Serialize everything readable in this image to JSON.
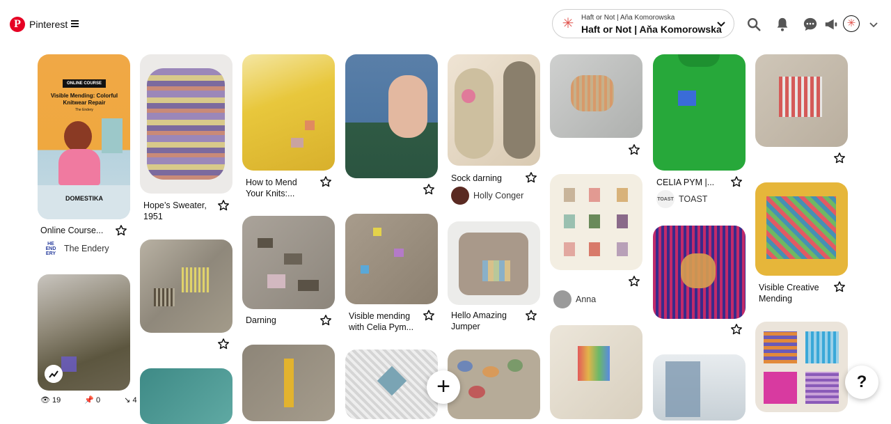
{
  "header": {
    "brand": "Pinterest",
    "board_small": "Haft or Not | Aňa Komorowska",
    "board_big": "Haft or Not | Aňa Komorowska",
    "avatar_glyph": "✳",
    "icons": [
      "search-icon",
      "notifications-icon",
      "messages-icon",
      "updates-icon"
    ]
  },
  "pins": {
    "p1": {
      "title": "Online Course...",
      "creator": "The Endery",
      "creator_badge": "HE END ERY",
      "badge": "ONLINE COURSE",
      "course_title": "Visible Mending: Colorful Knitwear Repair",
      "course_sub": "The Endery",
      "course_brand": "DOMESTIKA"
    },
    "p2": {
      "title": "Hope’s Sweater, 1951"
    },
    "p3": {
      "title": "How to Mend Your Knits:..."
    },
    "p4": {
      "title": ""
    },
    "p5": {
      "title": "Sock darning",
      "creator": "Holly Conger"
    },
    "p6": {
      "title": ""
    },
    "p7": {
      "title": "CELIA PYM |...",
      "creator": "TOAST",
      "creator_badge": "TOAST"
    },
    "p8": {
      "title": ""
    },
    "p10": {
      "title": "Darning"
    },
    "p11": {
      "title": "Visible mending with Celia Pym..."
    },
    "p12": {
      "title": "Hello Amazing Jumper"
    },
    "p13": {
      "title": "",
      "creator": "Anna"
    },
    "p14": {
      "title": "Visible Creative Mending"
    }
  },
  "stats": {
    "views": "19",
    "saves": "0",
    "clicks": "4"
  },
  "fab_label": "+",
  "help_label": "?",
  "colors": {
    "brand_red": "#e60023"
  }
}
